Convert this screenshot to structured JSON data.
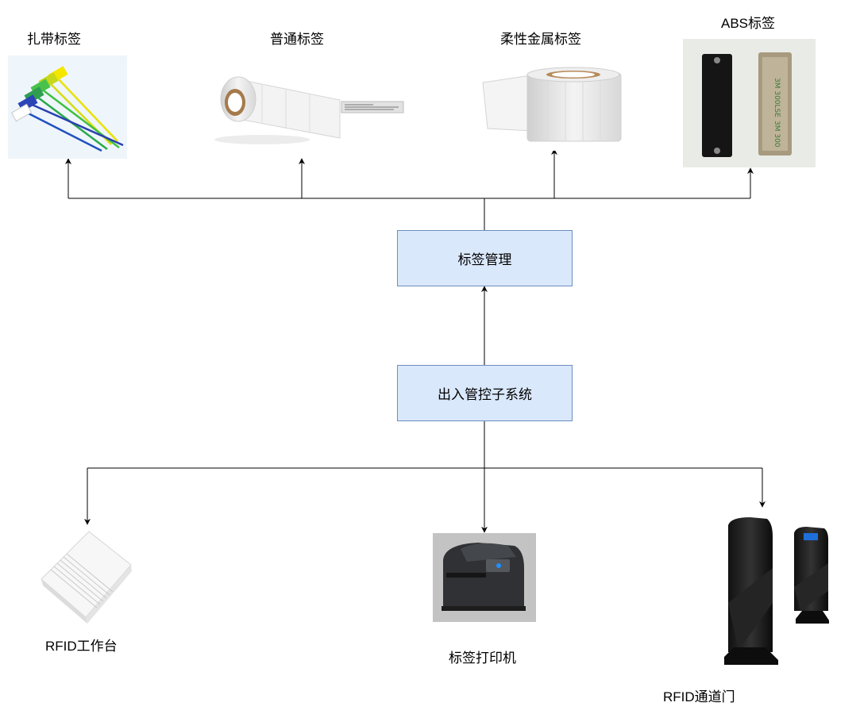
{
  "top_labels": {
    "zip_tag": "扎带标签",
    "normal_tag": "普通标签",
    "metal_tag": "柔性金属标签",
    "abs_tag": "ABS标签"
  },
  "nodes": {
    "tag_management": "标签管理",
    "access_subsystem": "出入管控子系统"
  },
  "bottom_labels": {
    "rfid_workstation": "RFID工作台",
    "tag_printer": "标签打印机",
    "rfid_gate": "RFID通道门"
  },
  "colors": {
    "node_fill": "#dae8fc",
    "node_stroke": "#6c8ebf",
    "connector": "#000000"
  }
}
